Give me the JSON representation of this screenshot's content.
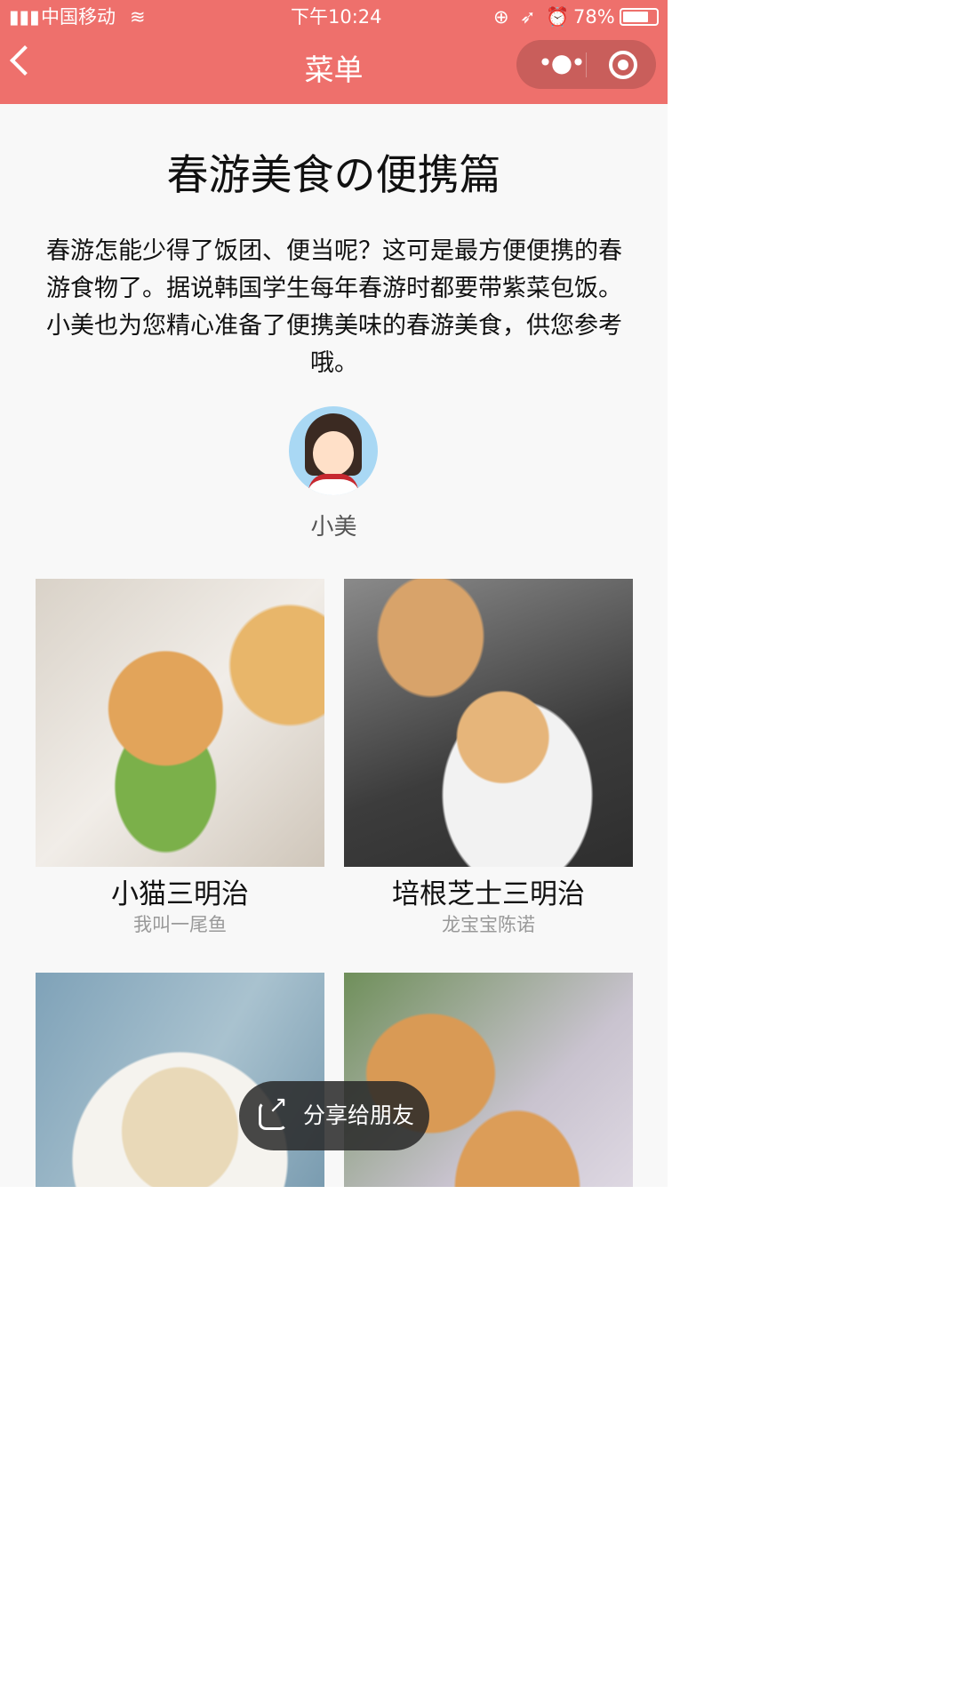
{
  "status_bar": {
    "carrier": "中国移动",
    "time": "下午10:24",
    "battery": "78%"
  },
  "nav": {
    "title": "菜单"
  },
  "article": {
    "title": "春游美食の便携篇",
    "intro": "春游怎能少得了饭团、便当呢？这可是最方便便携的春游食物了。据说韩国学生每年春游时都要带紫菜包饭。小美也为您精心准备了便携美味的春游美食，供您参考哦。",
    "author": "小美"
  },
  "recipes": [
    {
      "name": "小猫三明治",
      "author": "我叫一尾鱼"
    },
    {
      "name": "培根芝士三明治",
      "author": "龙宝宝陈诺"
    },
    {
      "name": "",
      "author": ""
    },
    {
      "name": "",
      "author": ""
    }
  ],
  "share": {
    "label": "分享给朋友"
  }
}
